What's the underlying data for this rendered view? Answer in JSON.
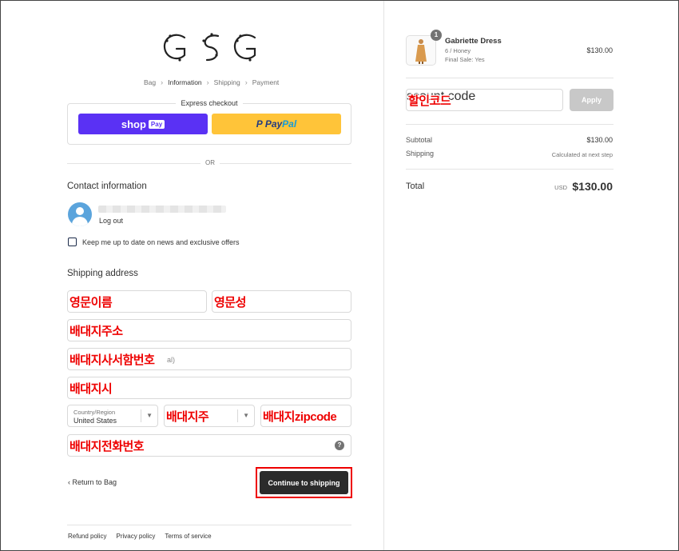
{
  "breadcrumb": {
    "items": [
      "Bag",
      "Information",
      "Shipping",
      "Payment"
    ]
  },
  "express": {
    "title": "Express checkout",
    "shoppay_text": "shop",
    "shoppay_badge": "Pay",
    "paypal_part1": "Pay",
    "paypal_part2": "Pal",
    "divider_text": "OR"
  },
  "contact": {
    "heading": "Contact information",
    "logout": "Log out",
    "newsletter_label": "Keep me up to date on news and exclusive offers"
  },
  "shipping": {
    "heading": "Shipping address",
    "first_name_placeholder": "",
    "first_name_overlay": "영문이름",
    "last_name_overlay": "영문성",
    "address_overlay": "배대지주소",
    "apt_overlay": "배대지사서함번호",
    "apt_placeholder_tail": "al)",
    "city_overlay": "배대지시",
    "country_label": "Country/Region",
    "country_value": "United States",
    "state_overlay": "배대지주",
    "zip_overlay": "배대지zipcode",
    "phone_overlay": "배대지전화번호",
    "help_glyph": "?"
  },
  "actions": {
    "return_label": "Return to Bag",
    "continue_label": "Continue to shipping"
  },
  "footer": {
    "links": [
      "Refund policy",
      "Privacy policy",
      "Terms of service"
    ]
  },
  "summary": {
    "qty": "1",
    "product_name": "Gabriette Dress",
    "product_variant": "6 / Honey",
    "product_final": "Final Sale: Yes",
    "product_price": "$130.00",
    "discount_overlay": "할인코드",
    "discount_placeholder": "scount code",
    "apply_label": "Apply",
    "subtotal_label": "Subtotal",
    "subtotal_value": "$130.00",
    "shipping_label": "Shipping",
    "shipping_value": "Calculated at next step",
    "total_label": "Total",
    "total_currency": "USD",
    "total_value": "$130.00"
  },
  "colors": {
    "shoppay": "#5a31f4",
    "paypal": "#ffc439",
    "primary_button": "#2b2b2b",
    "overlay_text": "#ee0000"
  }
}
